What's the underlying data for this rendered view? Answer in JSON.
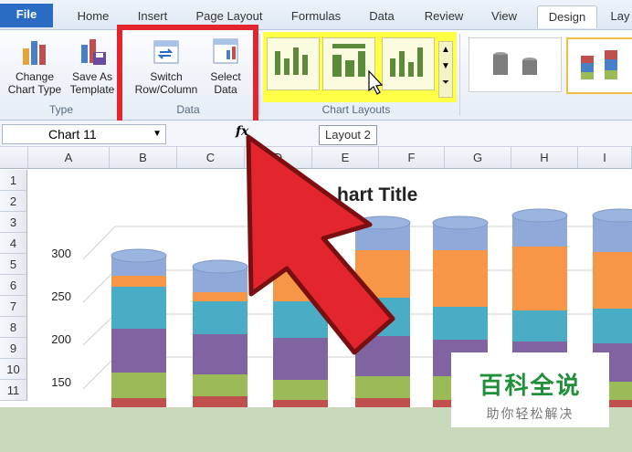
{
  "ribbon_tabs": [
    "File",
    "Home",
    "Insert",
    "Page Layout",
    "Formulas",
    "Data",
    "Review",
    "View",
    "Design",
    "Lay"
  ],
  "active_tab": "Design",
  "groups": {
    "type": {
      "label": "Type",
      "buttons": [
        {
          "label": "Change\nChart Type",
          "icon": "bar-chart-icon"
        },
        {
          "label": "Save As\nTemplate",
          "icon": "save-template-icon"
        }
      ]
    },
    "data": {
      "label": "Data",
      "buttons": [
        {
          "label": "Switch\nRow/Column",
          "icon": "switch-row-column-icon"
        },
        {
          "label": "Select\nData",
          "icon": "select-data-icon"
        }
      ]
    },
    "chart_layouts": {
      "label": "Chart Layouts"
    }
  },
  "formula_bar": {
    "name_box": "Chart 11",
    "fx": "fx",
    "tooltip": "Layout 2"
  },
  "columns": [
    "A",
    "B",
    "C",
    "D",
    "E",
    "F",
    "G",
    "H",
    "I"
  ],
  "rows": [
    "1",
    "2",
    "3",
    "4",
    "5",
    "6",
    "7",
    "8",
    "9",
    "10",
    "11"
  ],
  "chart": {
    "title": "hart Title",
    "y_ticks": [
      "300",
      "250",
      "200",
      "150"
    ]
  },
  "chart_data": {
    "type": "bar",
    "title": "hart Title",
    "ylim": [
      100,
      300
    ],
    "y_ticks": [
      300,
      250,
      200,
      150
    ],
    "stacked": true,
    "series_colors": [
      "#c0504d",
      "#9bbb59",
      "#8064a2",
      "#4bacc6",
      "#f79646",
      "#8fa9d8"
    ]
  },
  "watermark": {
    "title": "百科全说",
    "subtitle": "助你轻松解决"
  },
  "colors": {
    "accent_red": "#e3262d",
    "highlight_yellow": "#ffff46",
    "file_tab": "#2a6cc4"
  }
}
